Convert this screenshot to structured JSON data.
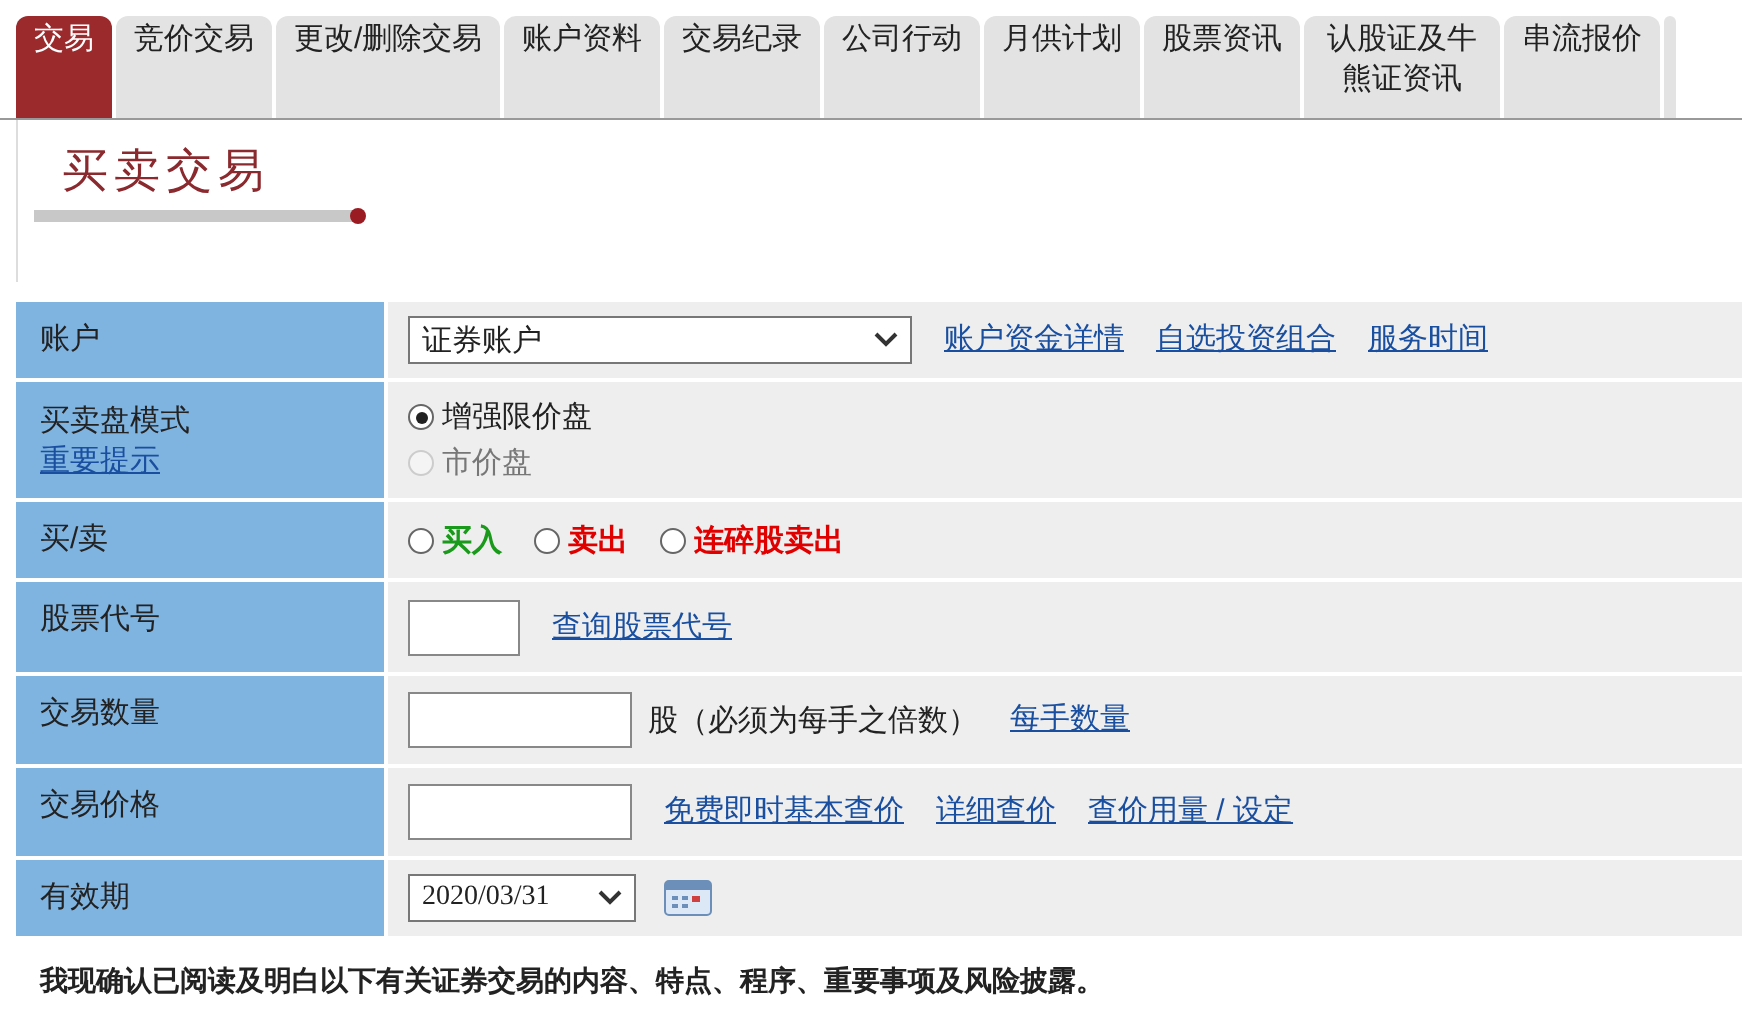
{
  "tabs": [
    {
      "label": "交易",
      "selected": true
    },
    {
      "label": "竞价交易",
      "selected": false
    },
    {
      "label": "更改/删除交易",
      "selected": false
    },
    {
      "label": "账户资料",
      "selected": false
    },
    {
      "label": "交易纪录",
      "selected": false
    },
    {
      "label": "公司行动",
      "selected": false
    },
    {
      "label": "月供计划",
      "selected": false
    },
    {
      "label": "股票资讯",
      "selected": false
    },
    {
      "label": "认股证及牛熊证资讯",
      "selected": false
    },
    {
      "label": "串流报价",
      "selected": false
    }
  ],
  "page_title": "买卖交易",
  "form": [
    {
      "label": "账户",
      "kind": "select",
      "select_value": "证券账户",
      "links": [
        "账户资金详情",
        "自选投资组合",
        "服务时间"
      ]
    },
    {
      "label": "买卖盘模式",
      "label_link": "重要提示",
      "kind": "radios_stacked",
      "options": [
        {
          "label": "增强限价盘",
          "selected": true,
          "disabled": false
        },
        {
          "label": "市价盘",
          "selected": false,
          "disabled": true
        }
      ]
    },
    {
      "label": "买/卖",
      "kind": "radios_inline",
      "options": [
        {
          "label": "买入",
          "selected": false,
          "color": "#1a9a1a"
        },
        {
          "label": "卖出",
          "selected": false,
          "color": "#e00000"
        },
        {
          "label": "连碎股卖出",
          "selected": false,
          "color": "#e00000"
        }
      ]
    },
    {
      "label": "股票代号",
      "kind": "input_short",
      "links": [
        "查询股票代号"
      ]
    },
    {
      "label": "交易数量",
      "kind": "input",
      "suffix": "股（必须为每手之倍数）",
      "links": [
        "每手数量"
      ]
    },
    {
      "label": "交易价格",
      "kind": "input",
      "links": [
        "免费即时基本查价",
        "详细查价",
        "查价用量 / 设定"
      ]
    },
    {
      "label": "有效期",
      "kind": "date",
      "select_value": "2020/03/31"
    }
  ],
  "declaration": "我现确认已阅读及明白以下有关证券交易的内容、特点、程序、重要事项及风险披露。"
}
